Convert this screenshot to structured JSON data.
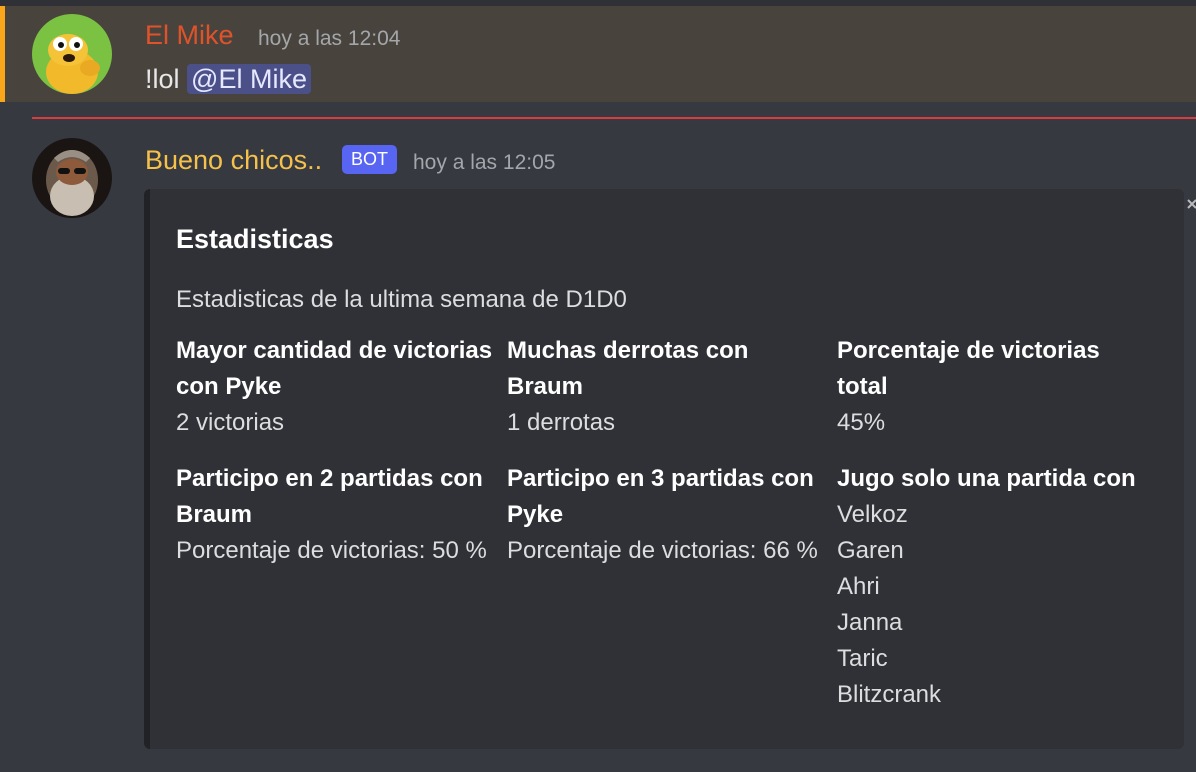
{
  "messages": [
    {
      "username": "El Mike",
      "timestamp": "hoy a las 12:04",
      "content_prefix": "!lol",
      "mention": "@El Mike",
      "username_color": "#e0532a",
      "highlight_color": "#faa61a"
    },
    {
      "username": "Bueno chicos..",
      "badge": "BOT",
      "timestamp": "hoy a las 12:05",
      "username_color": "#f5c14a",
      "badge_color": "#5865f2",
      "embed": {
        "title": "Estadisticas",
        "description": "Estadisticas de la ultima semana de D1D0",
        "fields": [
          {
            "name": "Mayor cantidad de victorias con Pyke",
            "value": "2 victorias"
          },
          {
            "name": "Muchas derrotas con Braum",
            "value": "1 derrotas"
          },
          {
            "name": "Porcentaje de victorias total",
            "value": "45%"
          },
          {
            "name": "Participo en 2 partidas con Braum",
            "value": "Porcentaje de victorias: 50 %"
          },
          {
            "name": "Participo en 3 partidas con Pyke",
            "value": "Porcentaje de victorias: 66 %"
          },
          {
            "name": "Jugo solo una partida con",
            "values": [
              "Velkoz",
              "Garen",
              "Ahri",
              "Janna",
              "Taric",
              "Blitzcrank"
            ]
          }
        ]
      }
    }
  ],
  "new_messages_divider_color": "#d83c3e",
  "icons": {
    "avatar1": "cartoon-dog-avatar",
    "avatar2": "bearded-character-avatar",
    "close": "close-icon"
  }
}
